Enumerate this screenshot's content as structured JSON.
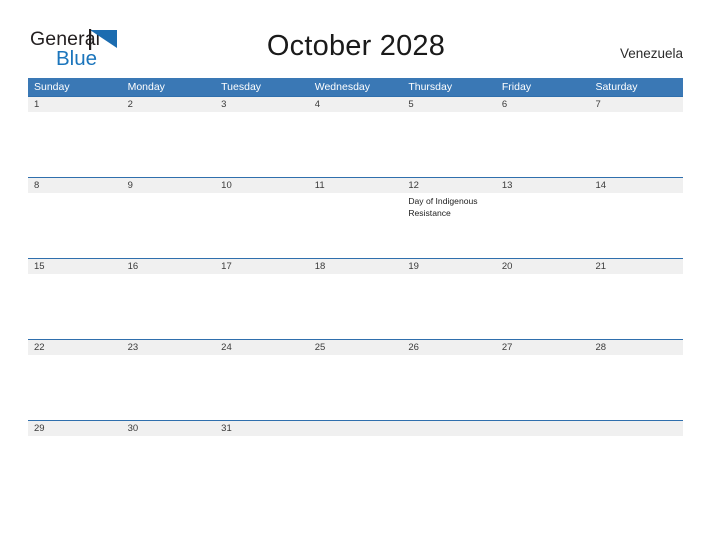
{
  "brand": {
    "word_one": "General",
    "word_two": "Blue",
    "mark_icon": "triangle-flag-icon",
    "accent_color": "#1b75bc"
  },
  "header": {
    "title": "October 2028",
    "country": "Venezuela"
  },
  "calendar": {
    "header_color": "#3a78b5",
    "row_border_color": "#2f6fad",
    "band_color": "#f0f0f0",
    "weekdays": [
      "Sunday",
      "Monday",
      "Tuesday",
      "Wednesday",
      "Thursday",
      "Friday",
      "Saturday"
    ],
    "weeks": [
      {
        "days": [
          {
            "num": "1",
            "event": ""
          },
          {
            "num": "2",
            "event": ""
          },
          {
            "num": "3",
            "event": ""
          },
          {
            "num": "4",
            "event": ""
          },
          {
            "num": "5",
            "event": ""
          },
          {
            "num": "6",
            "event": ""
          },
          {
            "num": "7",
            "event": ""
          }
        ]
      },
      {
        "days": [
          {
            "num": "8",
            "event": ""
          },
          {
            "num": "9",
            "event": ""
          },
          {
            "num": "10",
            "event": ""
          },
          {
            "num": "11",
            "event": ""
          },
          {
            "num": "12",
            "event": "Day of Indigenous Resistance"
          },
          {
            "num": "13",
            "event": ""
          },
          {
            "num": "14",
            "event": ""
          }
        ]
      },
      {
        "days": [
          {
            "num": "15",
            "event": ""
          },
          {
            "num": "16",
            "event": ""
          },
          {
            "num": "17",
            "event": ""
          },
          {
            "num": "18",
            "event": ""
          },
          {
            "num": "19",
            "event": ""
          },
          {
            "num": "20",
            "event": ""
          },
          {
            "num": "21",
            "event": ""
          }
        ]
      },
      {
        "days": [
          {
            "num": "22",
            "event": ""
          },
          {
            "num": "23",
            "event": ""
          },
          {
            "num": "24",
            "event": ""
          },
          {
            "num": "25",
            "event": ""
          },
          {
            "num": "26",
            "event": ""
          },
          {
            "num": "27",
            "event": ""
          },
          {
            "num": "28",
            "event": ""
          }
        ]
      },
      {
        "days": [
          {
            "num": "29",
            "event": ""
          },
          {
            "num": "30",
            "event": ""
          },
          {
            "num": "31",
            "event": ""
          },
          {
            "num": "",
            "event": ""
          },
          {
            "num": "",
            "event": ""
          },
          {
            "num": "",
            "event": ""
          },
          {
            "num": "",
            "event": ""
          }
        ]
      }
    ]
  }
}
